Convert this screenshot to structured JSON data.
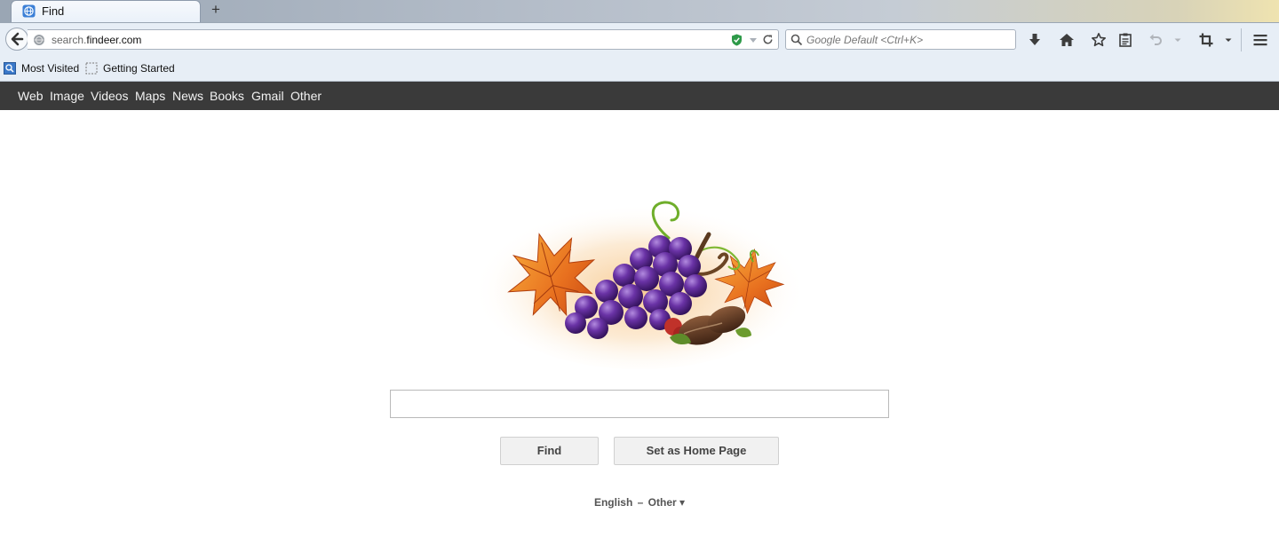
{
  "browser": {
    "tab_title": "Find",
    "new_tab_label": "+",
    "url_host_prefix": "search.",
    "url_domain": "findeer.com",
    "search_placeholder": "Google Default <Ctrl+K>",
    "bookmarks": [
      "Most Visited",
      "Getting Started"
    ]
  },
  "nav": {
    "items": [
      "Web",
      "Image",
      "Videos",
      "Maps",
      "News",
      "Books",
      "Gmail",
      "Other"
    ]
  },
  "main": {
    "search_value": "",
    "find_button": "Find",
    "home_button": "Set as Home Page",
    "language": "English",
    "separator": "–",
    "other_lang": "Other ▾"
  },
  "colors": {
    "nav_bg": "#3a3a3a",
    "chrome_bg": "#e7eef6",
    "grape": "#5b2a8c",
    "leaf": "#e8762a"
  }
}
